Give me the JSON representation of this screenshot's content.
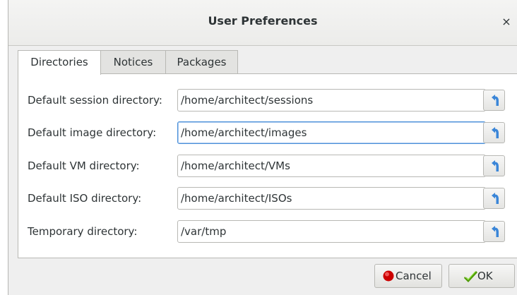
{
  "window": {
    "title": "User Preferences",
    "close_glyph": "×"
  },
  "tabs": [
    {
      "label": "Directories",
      "active": true
    },
    {
      "label": "Notices",
      "active": false
    },
    {
      "label": "Packages",
      "active": false
    }
  ],
  "directories": [
    {
      "label": "Default session directory:",
      "value": "/home/architect/sessions",
      "reset_icon": "revert-icon"
    },
    {
      "label": "Default image directory:",
      "value": "/home/architect/images",
      "reset_icon": "revert-icon"
    },
    {
      "label": "Default VM directory:",
      "value": "/home/architect/VMs",
      "reset_icon": "revert-icon"
    },
    {
      "label": "Default ISO directory:",
      "value": "/home/architect/ISOs",
      "reset_icon": "revert-icon"
    },
    {
      "label": "Temporary directory:",
      "value": "/var/tmp",
      "reset_icon": "revert-icon"
    }
  ],
  "footer": {
    "cancel_label": "Cancel",
    "ok_label": "OK"
  },
  "colors": {
    "accent": "#4a90d9",
    "cancel_icon": "#cc0000",
    "ok_icon": "#4e9a06"
  }
}
